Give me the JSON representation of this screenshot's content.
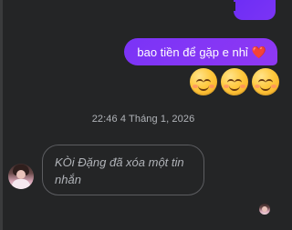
{
  "conversation": {
    "outgoing_message": {
      "text": "bao tiền để gặp e nhỉ",
      "heart_emoji": "❤️"
    },
    "emoji_message": {
      "icons": [
        "smiling-face-icon",
        "smiling-face-icon",
        "smiling-face-icon"
      ]
    },
    "timestamp": "22:46 4 Tháng 1, 2026",
    "incoming_deleted_message": {
      "text": "KÒi Đặng đã xóa một tin nhắn"
    }
  },
  "colors": {
    "background": "#242526",
    "outgoing_bubble": "#8036f5",
    "muted_text": "#b0b3b8",
    "bubble_border": "#5c5d61"
  }
}
